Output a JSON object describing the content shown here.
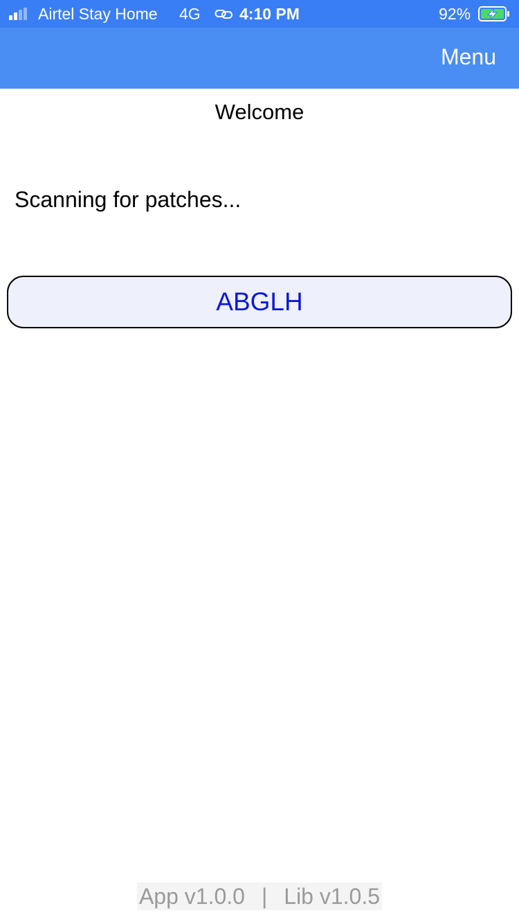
{
  "status_bar": {
    "carrier": "Airtel Stay Home",
    "network": "4G",
    "time": "4:10 PM",
    "battery_percent": "92%",
    "icons": [
      "signal-icon",
      "link-icon",
      "battery-charging-icon"
    ]
  },
  "nav": {
    "menu_label": "Menu",
    "background_color": "#4a8ef3"
  },
  "main": {
    "welcome": "Welcome",
    "scan_status": "Scanning for patches...",
    "devices": [
      {
        "label": "ABGLH"
      }
    ]
  },
  "footer": {
    "app_version": "App v1.0.0",
    "separator": "|",
    "lib_version": "Lib v1.0.5"
  },
  "colors": {
    "status_bar": "#3a7ef5",
    "button_text": "#0b18d8",
    "button_background": "#eef1fb",
    "footer_text": "#9a9a9a"
  }
}
